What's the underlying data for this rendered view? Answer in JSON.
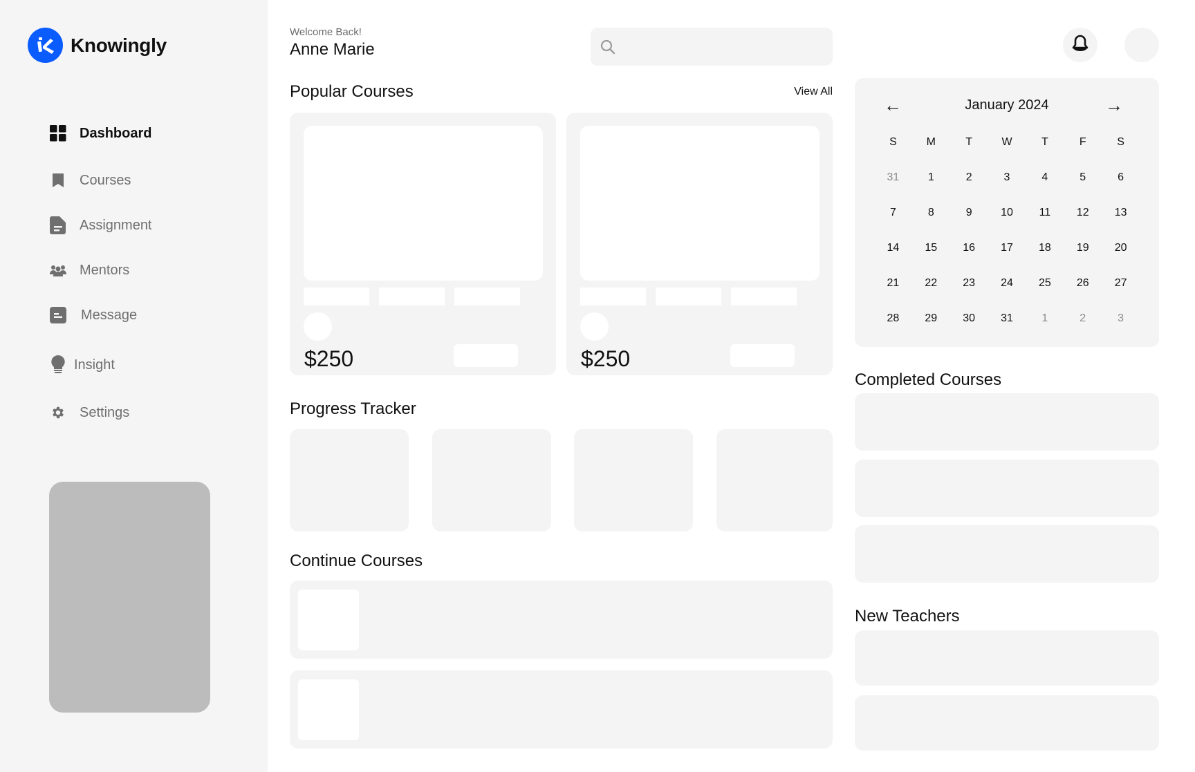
{
  "brand": {
    "name": "Knowingly",
    "color": "#0a5cff"
  },
  "sidebar": {
    "items": [
      {
        "label": "Dashboard",
        "icon": "grid-icon",
        "active": true
      },
      {
        "label": "Courses",
        "icon": "bookmark-icon"
      },
      {
        "label": "Assignment",
        "icon": "document-icon"
      },
      {
        "label": "Mentors",
        "icon": "people-icon"
      },
      {
        "label": "Message",
        "icon": "message-icon"
      },
      {
        "label": "Insight",
        "icon": "lightbulb-icon"
      },
      {
        "label": "Settings",
        "icon": "gear-icon"
      }
    ]
  },
  "header": {
    "welcome": "Welcome Back!",
    "username": "Anne Marie",
    "search": {
      "value": "",
      "placeholder": ""
    },
    "icons": [
      "bell-icon",
      "avatar"
    ]
  },
  "popular": {
    "title": "Popular Courses",
    "view_all": "View All",
    "cards": [
      {
        "price": "$250"
      },
      {
        "price": "$250"
      }
    ]
  },
  "progress": {
    "title": "Progress Tracker",
    "count": 4
  },
  "continue": {
    "title": "Continue Courses",
    "count": 2
  },
  "calendar": {
    "month": "January 2024",
    "prev": "←",
    "next": "→",
    "weekdays": [
      "S",
      "M",
      "T",
      "W",
      "T",
      "F",
      "S"
    ],
    "weeks": [
      [
        {
          "d": "31",
          "m": true
        },
        {
          "d": "1"
        },
        {
          "d": "2"
        },
        {
          "d": "3"
        },
        {
          "d": "4"
        },
        {
          "d": "5"
        },
        {
          "d": "6"
        }
      ],
      [
        {
          "d": "7"
        },
        {
          "d": "8"
        },
        {
          "d": "9"
        },
        {
          "d": "10"
        },
        {
          "d": "11"
        },
        {
          "d": "12"
        },
        {
          "d": "13"
        }
      ],
      [
        {
          "d": "14"
        },
        {
          "d": "15"
        },
        {
          "d": "16"
        },
        {
          "d": "17"
        },
        {
          "d": "18"
        },
        {
          "d": "19"
        },
        {
          "d": "20"
        }
      ],
      [
        {
          "d": "21"
        },
        {
          "d": "22"
        },
        {
          "d": "23"
        },
        {
          "d": "24"
        },
        {
          "d": "25"
        },
        {
          "d": "26"
        },
        {
          "d": "27"
        }
      ],
      [
        {
          "d": "28"
        },
        {
          "d": "29"
        },
        {
          "d": "30"
        },
        {
          "d": "31"
        },
        {
          "d": "1",
          "m": true
        },
        {
          "d": "2",
          "m": true
        },
        {
          "d": "3",
          "m": true
        }
      ]
    ]
  },
  "completed": {
    "title": "Completed Courses",
    "count": 3
  },
  "teachers": {
    "title": "New Teachers",
    "count": 2
  }
}
